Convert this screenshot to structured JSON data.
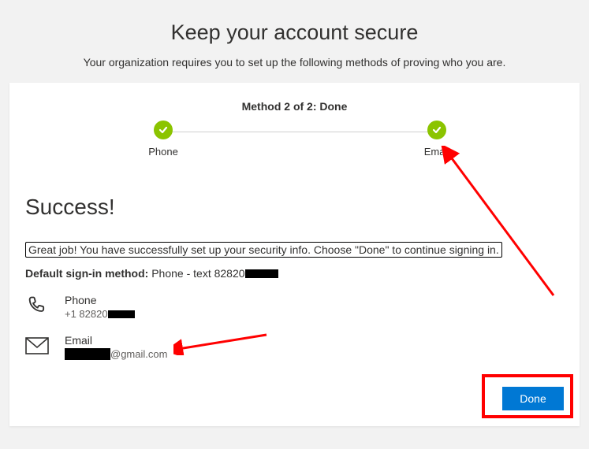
{
  "page": {
    "title": "Keep your account secure",
    "subtitle": "Your organization requires you to set up the following methods of proving who you are."
  },
  "methods_header": "Method 2 of 2: Done",
  "steps": {
    "phone": "Phone",
    "email": "Email"
  },
  "success": {
    "heading": "Success!",
    "message": "Great job! You have successfully set up your security info. Choose \"Done\" to continue signing in.",
    "default_label": "Default sign-in method:",
    "default_value_prefix": " Phone - text 82820"
  },
  "method_phone": {
    "label": "Phone",
    "value_prefix": "+1 82820"
  },
  "method_email": {
    "label": "Email",
    "value_suffix": "@gmail.com"
  },
  "buttons": {
    "done": "Done"
  }
}
